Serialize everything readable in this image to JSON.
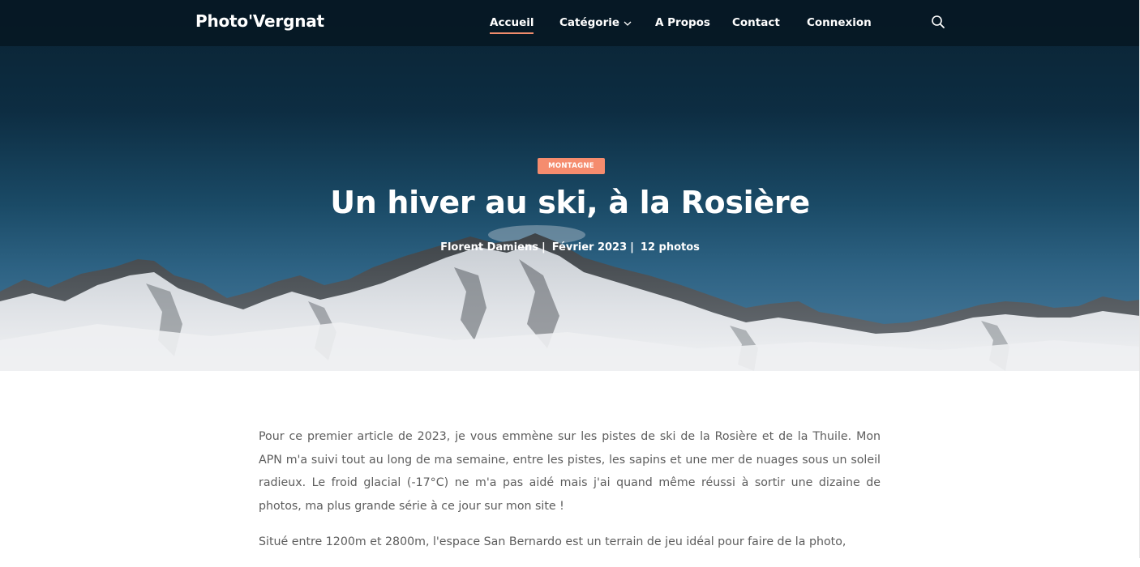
{
  "colors": {
    "accent": "#f58c6e",
    "nav_bg": "#061824",
    "hero_sky": "#0d2d42",
    "text_body": "#5d5d5d"
  },
  "nav": {
    "brand": "Photo'Vergnat",
    "items": [
      {
        "label": "Accueil",
        "active": true
      },
      {
        "label": "Catégorie",
        "has_dropdown": true
      },
      {
        "label": "A Propos"
      },
      {
        "label": "Contact"
      },
      {
        "label": "Connexion"
      }
    ],
    "search_icon": "search-icon"
  },
  "hero": {
    "category_tag": "MONTAGNE",
    "title": "Un hiver au ski, à la Rosière",
    "author": "Florent Damiens",
    "date": "Février 2023",
    "photo_count": "12 photos",
    "separator": "|"
  },
  "article": {
    "paragraphs": [
      "Pour ce premier article de 2023, je vous emmène sur les pistes de ski de la Rosière et de la Thuile. Mon APN m'a suivi tout au long de ma semaine, entre les pistes, les sapins et une mer de nuages sous un soleil radieux. Le froid glacial (-17°C) ne m'a pas aidé mais j'ai quand même réussi à sortir une dizaine de photos, ma plus grande série à ce jour sur mon site !",
      "Situé entre 1200m et 2800m, l'espace San Bernardo est un terrain de jeu idéal pour faire de la photo,"
    ]
  }
}
